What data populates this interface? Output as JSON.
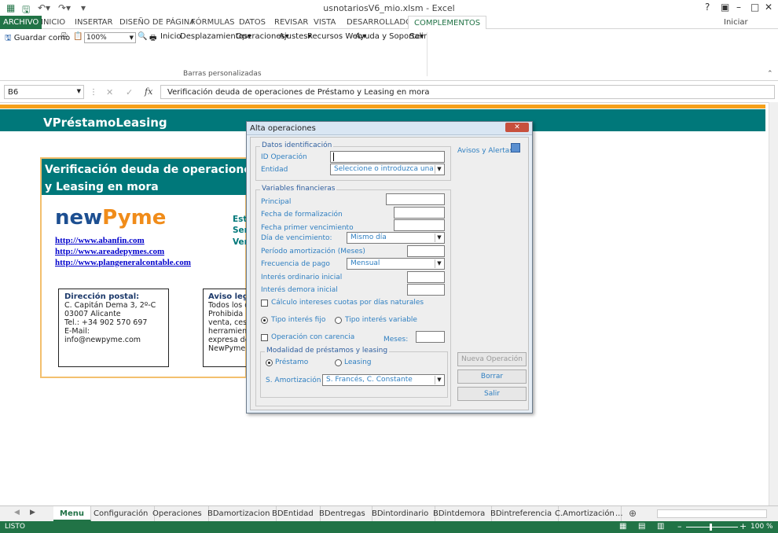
{
  "window": {
    "title": "usnotariosV6_mio.xlsm - Excel",
    "signin": "Iniciar sesión",
    "help": "?",
    "min": "–",
    "restore": "□",
    "close": "✕"
  },
  "ribbon_tabs": [
    "ARCHIVO",
    "INICIO",
    "INSERTAR",
    "DISEÑO DE PÁGINA",
    "FÓRMULAS",
    "DATOS",
    "REVISAR",
    "VISTA",
    "DESARROLLADOR",
    "COMPLEMENTOS"
  ],
  "toolbar": {
    "save_as": "Guardar como",
    "zoom": "100%",
    "inicio": "Inicio",
    "desplazamientos": "Desplazamientos",
    "operaciones": "Operaciones",
    "ajustes": "Ajustes",
    "recursos": "Recursos Web",
    "ayuda": "Ayuda y Soporte",
    "salir": "Salir",
    "group_label": "Barras personalizadas"
  },
  "formula_bar": {
    "name_box": "B6",
    "formula": "Verificación deuda de operaciones de Préstamo y Leasing en mora"
  },
  "sheet": {
    "banner": "VPréstamoLeasing",
    "card_title_1": "Verificación deuda de operaciones",
    "card_title_2": "y Leasing en mora",
    "logo_a": "new",
    "logo_b": "Pyme",
    "links": [
      "http://www.abanfin.com",
      "http://www.areadepymes.com",
      "http://www.plangeneralcontable.com"
    ],
    "side_texts": [
      "Esta",
      "Serv",
      "Vers"
    ],
    "address": {
      "heading": "Dirección postal:",
      "lines": [
        "C. Capitán Dema 3, 2º-C",
        "03007 Alicante",
        "Tel.: +34 902 570 697",
        "E-Mail: info@newpyme.com"
      ]
    },
    "legal": {
      "heading": "Aviso legal",
      "lines": [
        "Todos los de",
        "Prohibida la",
        "venta, cesio",
        "herramienta",
        "expresa del",
        "NewPyme S."
      ]
    }
  },
  "dialog": {
    "title": "Alta operaciones",
    "close": "✕",
    "ident": {
      "legend": "Datos identificación",
      "id_label": "ID Operación",
      "entidad_label": "Entidad",
      "entidad_value": "Seleccione o introduzca una"
    },
    "avisos": "Avisos y Alertas",
    "fin": {
      "legend": "Variables financieras",
      "principal": "Principal",
      "fecha_form": "Fecha de formalización",
      "fecha_venc": "Fecha primer vencimiento",
      "dia_venc": "Día de vencimiento:",
      "dia_venc_value": "Mismo día",
      "periodo": "Período amortización  (Meses)",
      "frecuencia": "Frecuencia de pago",
      "frecuencia_value": "Mensual",
      "int_ord": "Interés ordinario inicial",
      "int_dem": "Interés demora inicial",
      "calc_chk": "Cálculo intereses cuotas por días naturales",
      "tipo_fijo": "Tipo interés fijo",
      "tipo_var": "Tipo interés variable",
      "carencia": "Operación con carencia",
      "meses": "Meses:"
    },
    "modalidad": {
      "legend": "Modalidad de préstamos y leasing",
      "prestamo": "Préstamo",
      "leasing": "Leasing",
      "amort_label": "S. Amortización",
      "amort_value": "S. Francés, C. Constante"
    },
    "buttons": {
      "nueva": "Nueva Operación",
      "borrar": "Borrar",
      "salir": "Salir"
    }
  },
  "sheet_tabs": [
    "Menu",
    "Configuración",
    "Operaciones",
    "BDamortizacion",
    "BDEntidad",
    "BDentregas",
    "BDintordinario",
    "BDintdemora",
    "BDintreferencia",
    "C.Amortización",
    "..."
  ],
  "status": {
    "mode": "LISTO",
    "zoom": "100 %"
  }
}
